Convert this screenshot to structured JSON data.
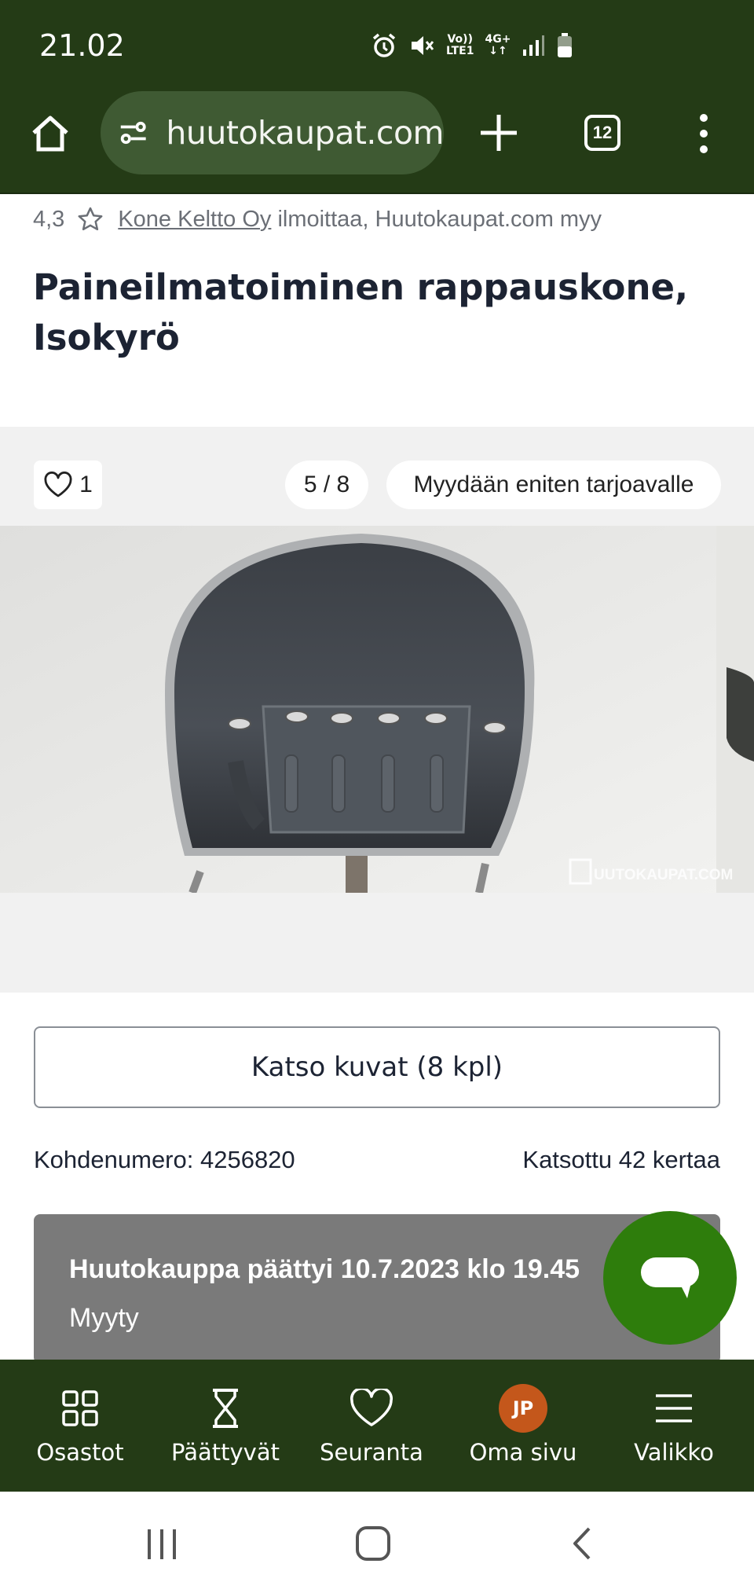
{
  "status_bar": {
    "time": "21.02",
    "network_label_top": "Vo))",
    "network_label_bottom": "LTE1",
    "network_type": "4G+"
  },
  "browser": {
    "url": "huutokaupat.com",
    "tab_count": "12"
  },
  "listing": {
    "rating": "4,3",
    "seller_link": "Kone Keltto Oy",
    "seller_text": " ilmoittaa, Huutokaupat.com myy",
    "title": "Paineilmatoiminen rappauskone, Isokyrö",
    "like_count": "1",
    "photo_counter": "5 / 8",
    "sale_type": "Myydään eniten tarjoavalle",
    "watermark": "UUTOKAUPAT.COM",
    "view_photos_button": "Katso kuvat (8 kpl)",
    "object_number": "Kohdenumero: 4256820",
    "view_count": "Katsottu 42 kertaa",
    "auction_end": "Huutokauppa päättyi 10.7.2023 klo 19.45",
    "status": "Myyty"
  },
  "bottom_nav": {
    "items": [
      {
        "label": "Osastot",
        "icon": "grid-icon"
      },
      {
        "label": "Päättyvät",
        "icon": "hourglass-icon"
      },
      {
        "label": "Seuranta",
        "icon": "heart-icon"
      },
      {
        "label": "Oma sivu",
        "icon": "avatar",
        "initials": "JP"
      },
      {
        "label": "Valikko",
        "icon": "hamburger-icon"
      }
    ]
  },
  "colors": {
    "header_green": "#243b16",
    "chat_green": "#2e7d0c",
    "avatar_orange": "#c4571b",
    "card_gray": "#7a7a7a"
  }
}
